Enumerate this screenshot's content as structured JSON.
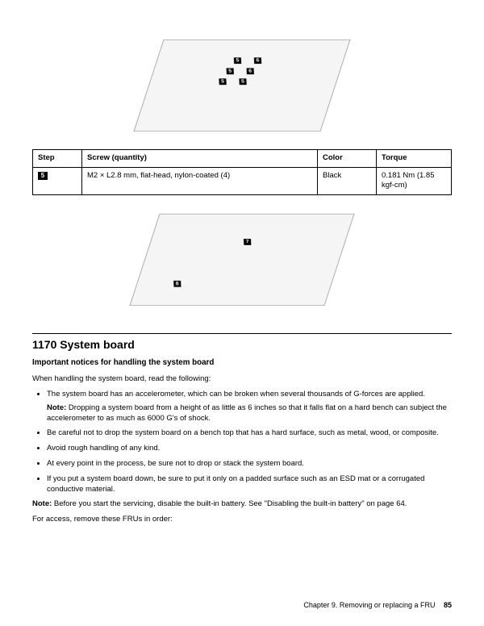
{
  "table": {
    "headers": {
      "step": "Step",
      "screw": "Screw (quantity)",
      "color": "Color",
      "torque": "Torque"
    },
    "row": {
      "step": "5",
      "screw": "M2 × L2.8 mm, flat-head, nylon-coated (4)",
      "color": "Black",
      "torque": "0.181 Nm (1.85 kgf-cm)"
    }
  },
  "callouts_top": [
    "5",
    "6",
    "6",
    "5",
    "5",
    "5"
  ],
  "callouts_bottom": [
    "7",
    "8"
  ],
  "section": {
    "title": "1170 System board",
    "subhead": "Important notices for handling the system board",
    "intro": "When handling the system board, read the following:",
    "bullets": [
      {
        "text": "The system board has an accelerometer, which can be broken when several thousands of G-forces are applied.",
        "note": "Dropping a system board from a height of as little as 6 inches so that it falls flat on a hard bench can subject the accelerometer to as much as 6000 G's of shock."
      },
      {
        "text": "Be careful not to drop the system board on a bench top that has a hard surface, such as metal, wood, or composite."
      },
      {
        "text": "Avoid rough handling of any kind."
      },
      {
        "text": "At every point in the process, be sure not to drop or stack the system board."
      },
      {
        "text": "If you put a system board down, be sure to put it only on a padded surface such as an ESD mat or a corrugated conductive material."
      }
    ],
    "note_label": "Note:",
    "servicing_note": "Before you start the servicing, disable the built-in battery. See \"Disabling the built-in battery\" on page 64.",
    "access_line": "For access, remove these FRUs in order:"
  },
  "footer": {
    "chapter": "Chapter 9. Removing or replacing a FRU",
    "page": "85"
  }
}
